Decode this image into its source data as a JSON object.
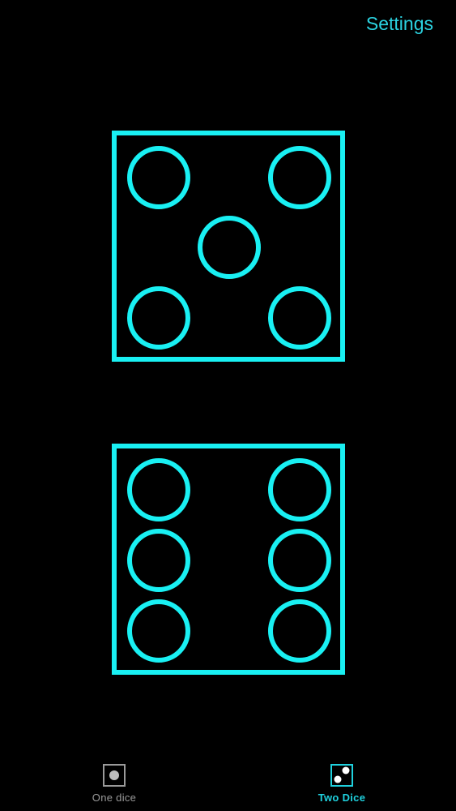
{
  "header": {
    "settings_label": "Settings"
  },
  "dice": [
    {
      "value": 5
    },
    {
      "value": 6
    }
  ],
  "tabbar": {
    "tabs": [
      {
        "label": "One dice",
        "icon": "one-die-icon",
        "selected": false
      },
      {
        "label": "Two Dice",
        "icon": "two-dice-icon",
        "selected": true
      }
    ]
  },
  "colors": {
    "accent": "#19f0f3",
    "background": "#000000",
    "tab_inactive": "#9a9a9a",
    "tab_active": "#1fd1de"
  }
}
